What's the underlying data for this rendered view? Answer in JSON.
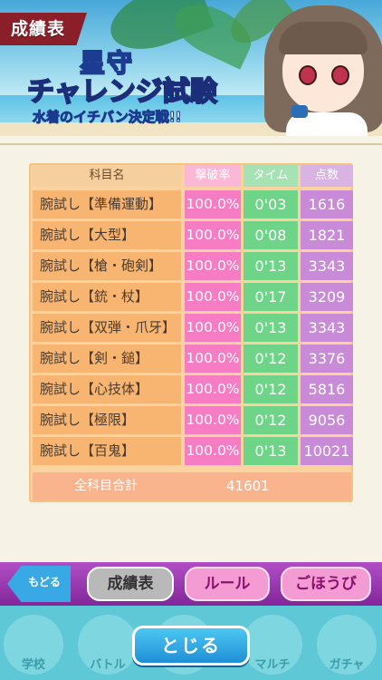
{
  "header": {
    "tag_label": "成績表"
  },
  "event": {
    "title_top": "星守",
    "title_main": "チャレンジ試験",
    "subtitle": "水着のイチバン決定戦!!"
  },
  "table": {
    "columns": [
      "科目名",
      "撃破率",
      "タイム",
      "点数"
    ],
    "rows": [
      {
        "name": "腕試し【準備運動】",
        "rate": "100.0%",
        "time": "0'03",
        "score": "1616"
      },
      {
        "name": "腕試し【大型】",
        "rate": "100.0%",
        "time": "0'08",
        "score": "1821"
      },
      {
        "name": "腕試し【槍・砲剣】",
        "rate": "100.0%",
        "time": "0'13",
        "score": "3343"
      },
      {
        "name": "腕試し【銃・杖】",
        "rate": "100.0%",
        "time": "0'17",
        "score": "3209"
      },
      {
        "name": "腕試し【双弾・爪牙】",
        "rate": "100.0%",
        "time": "0'13",
        "score": "3343"
      },
      {
        "name": "腕試し【剣・鎚】",
        "rate": "100.0%",
        "time": "0'12",
        "score": "3376"
      },
      {
        "name": "腕試し【心技体】",
        "rate": "100.0%",
        "time": "0'12",
        "score": "5816"
      },
      {
        "name": "腕試し【極限】",
        "rate": "100.0%",
        "time": "0'12",
        "score": "9056"
      },
      {
        "name": "腕試し【百鬼】",
        "rate": "100.0%",
        "time": "0'13",
        "score": "10021"
      }
    ],
    "total_label": "全科目合計",
    "total_value": "41601"
  },
  "buttons": {
    "back": "もどる",
    "results": "成績表",
    "rules": "ルール",
    "rewards": "ごほうび",
    "close": "とじる"
  },
  "nav": {
    "school": "学校",
    "battle": "バトル",
    "academy": "",
    "multi": "マルチ",
    "gacha": "ガチャ"
  },
  "colors": {
    "rate_col": "#f67dc3",
    "time_col": "#6ed488",
    "score_col": "#c98ad8",
    "name_col": "#f8b571",
    "button_bar": "#9a3ab0",
    "nav_bg": "#5ec8d6"
  }
}
